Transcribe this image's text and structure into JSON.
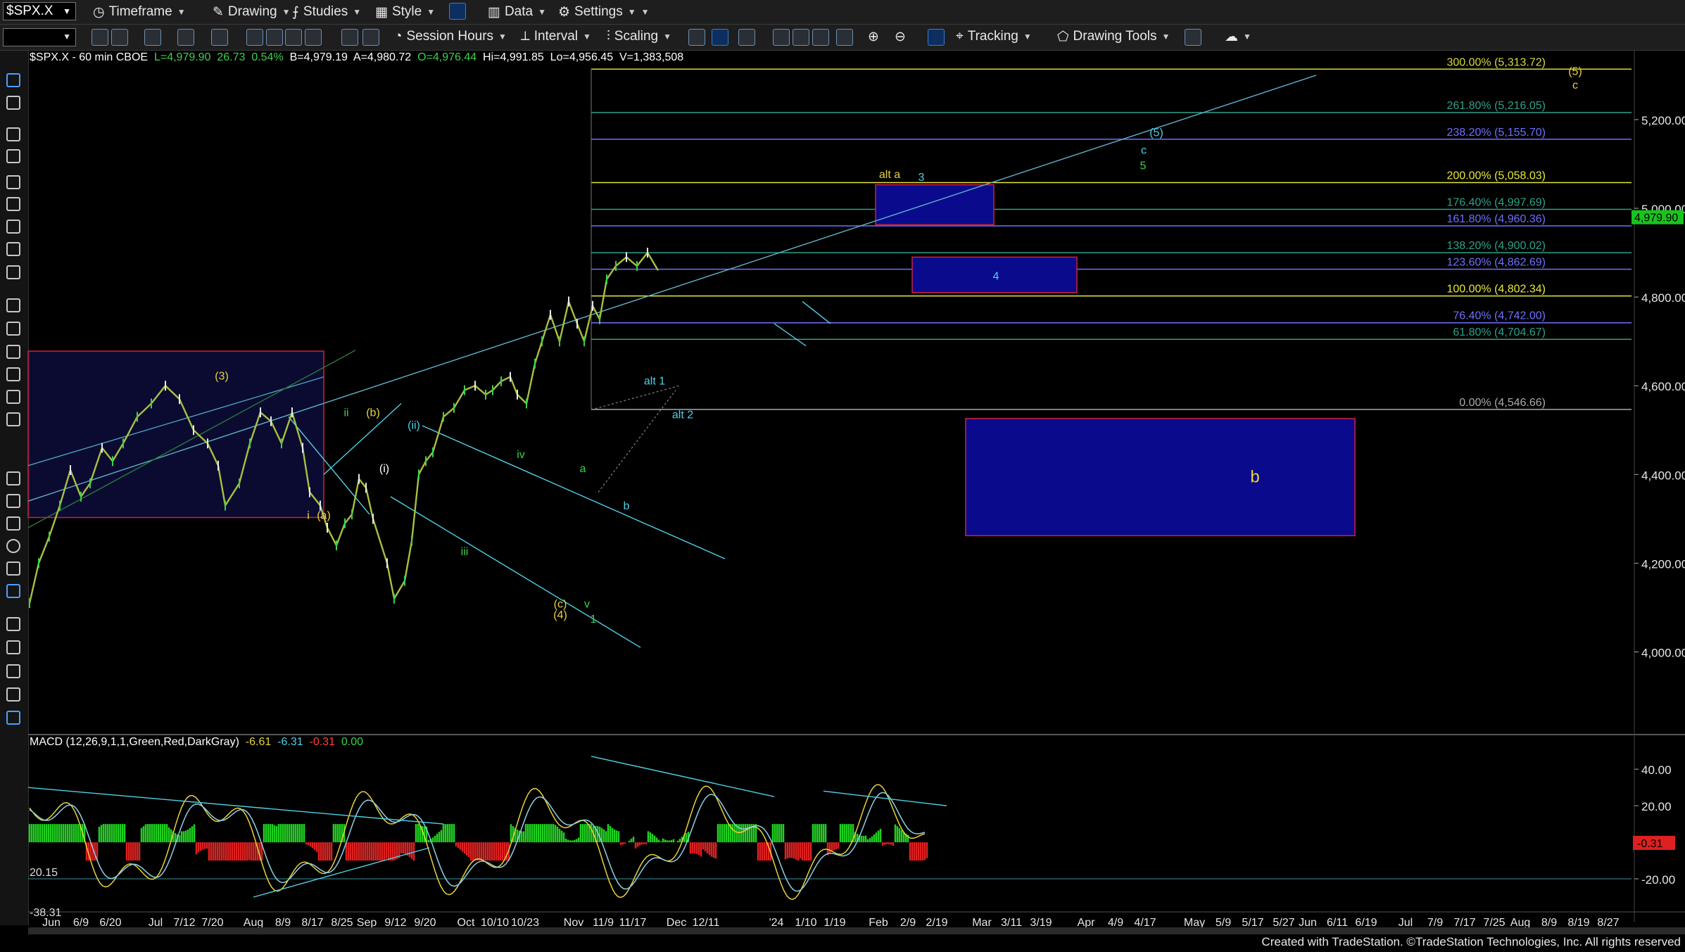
{
  "toolbar1": {
    "symbol": "$SPX.X",
    "items": [
      "Timeframe",
      "Drawing",
      "Studies",
      "Style",
      "Data",
      "Settings"
    ]
  },
  "toolbar2": {
    "items": [
      "Session Hours",
      "Interval",
      "Scaling",
      "Tracking",
      "Drawing Tools"
    ]
  },
  "info_line": {
    "symbol": "$SPX.X - 60 min  CBOE",
    "last": "L=4,979.90",
    "change": "26.73",
    "pct": "0.54%",
    "bid": "B=4,979.19",
    "ask": "A=4,980.72",
    "open": "O=4,976.44",
    "high": "Hi=4,991.85",
    "low": "Lo=4,956.45",
    "volume": "V=1,383,508"
  },
  "macd_info": {
    "label": "MACD (12,26,9,1,1,Green,Red,DarkGray)",
    "v1": "-6.61",
    "v2": "-6.31",
    "v3": "-0.31",
    "v4": "0.00"
  },
  "credit": "Created with TradeStation. ©TradeStation Technologies, Inc. All rights reserved",
  "chart_data": {
    "type": "line",
    "title": "$SPX.X - 60 min",
    "price_axis": {
      "ylim": [
        3820,
        5330
      ],
      "ticks": [
        "4,000.00",
        "4,200.00",
        "4,400.00",
        "4,600.00",
        "4,800.00",
        "5,000.00",
        "5,200.00"
      ],
      "tick_values": [
        4000,
        4200,
        4400,
        4600,
        4800,
        5000,
        5200
      ],
      "last_price_label": "4,979.90",
      "last_price": 4979.9
    },
    "macd_axis": {
      "ylim": [
        -35,
        52
      ],
      "ticks": [
        "40.00",
        "20.00",
        "-20.00"
      ],
      "tick_values": [
        40,
        20,
        -20
      ],
      "current_label": "-0.31",
      "current": -0.31,
      "left_labels": [
        "20.15",
        "-38.31"
      ]
    },
    "x_axis": {
      "labels": [
        "Jun",
        "6/9",
        "6/20",
        "Jul",
        "7/12",
        "7/20",
        "Aug",
        "8/9",
        "8/17",
        "8/25",
        "Sep",
        "9/12",
        "9/20",
        "Oct",
        "10/10",
        "10/23",
        "Nov",
        "11/9",
        "11/17",
        "Dec",
        "12/11",
        "'24",
        "1/10",
        "1/19",
        "Feb",
        "2/9",
        "2/19",
        "Mar",
        "3/11",
        "3/19",
        "Apr",
        "4/9",
        "4/17",
        "May",
        "5/9",
        "5/17",
        "5/27",
        "Jun",
        "6/11",
        "6/19",
        "Jul",
        "7/9",
        "7/17",
        "7/25",
        "Aug",
        "8/9",
        "8/19",
        "8/27"
      ],
      "positions": [
        73,
        115,
        157,
        221,
        262,
        302,
        360,
        402,
        444,
        486,
        521,
        562,
        604,
        662,
        703,
        746,
        815,
        857,
        899,
        961,
        1003,
        1103,
        1145,
        1186,
        1248,
        1290,
        1331,
        1395,
        1437,
        1479,
        1543,
        1585,
        1627,
        1697,
        1738,
        1780,
        1824,
        1858,
        1900,
        1941,
        1997,
        2039,
        2081,
        2123,
        2160,
        2201,
        2243,
        2285
      ]
    },
    "price_series": {
      "x": [
        42,
        55,
        70,
        85,
        100,
        115,
        128,
        145,
        160,
        175,
        195,
        215,
        235,
        255,
        275,
        295,
        310,
        320,
        340,
        355,
        370,
        385,
        400,
        415,
        430,
        440,
        455,
        465,
        478,
        490,
        500,
        510,
        520,
        530,
        550,
        560,
        575,
        585,
        595,
        605,
        615,
        630,
        645,
        660,
        675,
        690,
        700,
        712,
        725,
        735,
        748,
        760,
        770,
        782,
        795,
        808,
        820,
        830,
        842,
        852,
        862,
        875,
        890,
        905,
        920,
        935,
        950,
        965,
        980,
        995,
        1010,
        1025,
        1040,
        1052,
        1065,
        1080,
        1095,
        1110,
        1125,
        1140,
        1155,
        1168,
        1180,
        1192,
        1205,
        1215,
        1225,
        1235,
        1245,
        1252,
        1260,
        1268,
        1275,
        1283,
        1290,
        1297,
        1303,
        1308,
        1312,
        1318
      ],
      "y": [
        4110,
        4200,
        4260,
        4330,
        4410,
        4350,
        4380,
        4460,
        4430,
        4470,
        4530,
        4560,
        4600,
        4570,
        4500,
        4470,
        4420,
        4330,
        4380,
        4470,
        4540,
        4520,
        4470,
        4540,
        4460,
        4360,
        4330,
        4280,
        4240,
        4290,
        4310,
        4390,
        4370,
        4300,
        4200,
        4120,
        4160,
        4250,
        4400,
        4430,
        4450,
        4530,
        4550,
        4590,
        4600,
        4580,
        4590,
        4610,
        4620,
        4580,
        4560,
        4650,
        4700,
        4760,
        4700,
        4790,
        4740,
        4700,
        4780,
        4750,
        4840,
        4870,
        4890,
        4870,
        4900,
        4860,
        4930,
        4960,
        4960,
        4940,
        5000,
        5048,
        4980,
        4960,
        4979.9,
        4980,
        4968,
        4974,
        4979.9,
        4980,
        4979.9,
        4975,
        4979.9,
        4979.9,
        4980,
        4979.9,
        4979.9,
        4979.9,
        4979.9,
        4979.9,
        4979.9,
        4979.9,
        4979.9,
        4979.9,
        4979.9,
        4979.9,
        4979.9,
        4979.9,
        4979.9,
        4979.9
      ],
      "visible_count": 66
    },
    "fib_levels": [
      {
        "label": "300.00% (5,313.72)",
        "value": 5313.72,
        "color": "#d8d83a"
      },
      {
        "label": "261.80% (5,216.05)",
        "value": 5216.05,
        "color": "#2fa08a"
      },
      {
        "label": "238.20% (5,155.70)",
        "value": 5155.7,
        "color": "#6f6fff"
      },
      {
        "label": "200.00% (5,058.03)",
        "value": 5058.03,
        "color": "#e8e83a"
      },
      {
        "label": "176.40% (4,997.69)",
        "value": 4997.69,
        "color": "#2fa08a"
      },
      {
        "label": "161.80% (4,960.36)",
        "value": 4960.36,
        "color": "#6f6fff"
      },
      {
        "label": "138.20% (4,900.02)",
        "value": 4900.02,
        "color": "#2fa08a"
      },
      {
        "label": "123.60% (4,862.69)",
        "value": 4862.69,
        "color": "#6f6fff"
      },
      {
        "label": "100.00% (4,802.34)",
        "value": 4802.34,
        "color": "#e8e83a"
      },
      {
        "label": "76.40% (4,742.00)",
        "value": 4742.0,
        "color": "#6f6fff"
      },
      {
        "label": "61.80% (4,704.67)",
        "value": 4704.67,
        "color": "#2fa08a"
      },
      {
        "label": "0.00% (4,546.66)",
        "value": 4546.66,
        "color": "#aaaaaa"
      }
    ],
    "wave_labels": [
      {
        "text": "(3)",
        "color": "#e8d23b",
        "x": 315,
        "price": 4614
      },
      {
        "text": "i",
        "color": "#e8d23b",
        "x": 438,
        "price": 4300
      },
      {
        "text": "(a)",
        "color": "#e8d23b",
        "x": 460,
        "price": 4300
      },
      {
        "text": "ii",
        "color": "#3bd14a",
        "x": 492,
        "price": 4531
      },
      {
        "text": "(b)",
        "color": "#e8d23b",
        "x": 530,
        "price": 4531
      },
      {
        "text": "(i)",
        "color": "#fff",
        "x": 546,
        "price": 4405
      },
      {
        "text": "(ii)",
        "color": "#4fd0e6",
        "x": 588,
        "price": 4503
      },
      {
        "text": "iv",
        "color": "#3bd14a",
        "x": 740,
        "price": 4437
      },
      {
        "text": "iii",
        "color": "#3bd14a",
        "x": 660,
        "price": 4218
      },
      {
        "text": "(c)",
        "color": "#e8d23b",
        "x": 796,
        "price": 4100
      },
      {
        "text": "(4)",
        "color": "#e8d23b",
        "x": 796,
        "price": 4075
      },
      {
        "text": "v",
        "color": "#3bd14a",
        "x": 834,
        "price": 4100
      },
      {
        "text": "1",
        "color": "#3bd14a",
        "x": 843,
        "price": 4066
      },
      {
        "text": "a",
        "color": "#3bd14a",
        "x": 828,
        "price": 4405
      },
      {
        "text": "b",
        "color": "#4fd0e6",
        "x": 890,
        "price": 4321
      },
      {
        "text": "alt 1",
        "color": "#4fd0e6",
        "x": 930,
        "price": 4603
      },
      {
        "text": "alt 2",
        "color": "#4fd0e6",
        "x": 970,
        "price": 4527
      },
      {
        "text": "alt a",
        "color": "#e8d23b",
        "x": 1264,
        "price": 5068
      },
      {
        "text": "3",
        "color": "#4fd0e6",
        "x": 1309,
        "price": 5062
      },
      {
        "text": "4",
        "color": "#4fd0e6",
        "x": 1415,
        "price": 4839
      },
      {
        "text": "c",
        "color": "#4fd0e6",
        "x": 1625,
        "price": 5123
      },
      {
        "text": "5",
        "color": "#3bd14a",
        "x": 1624,
        "price": 5088
      },
      {
        "text": "(5)",
        "color": "#4fd0e6",
        "x": 1643,
        "price": 5163
      },
      {
        "text": "(5)",
        "color": "#e8d23b",
        "x": 2238,
        "price": 5301
      },
      {
        "text": "c",
        "color": "#e8d23b",
        "x": 2238,
        "price": 5270
      },
      {
        "text": "b",
        "color": "#e8d23b",
        "x": 1783,
        "price": 4382
      }
    ],
    "boxes": [
      {
        "x1": 40,
        "x2": 460,
        "p1": 4678,
        "p2": 4303
      },
      {
        "x1": 1244,
        "x2": 1412,
        "p1": 5053,
        "p2": 4963
      },
      {
        "x1": 1296,
        "x2": 1530,
        "p1": 4890,
        "p2": 4810
      },
      {
        "x1": 1372,
        "x2": 1925,
        "p1": 4526,
        "p2": 4262
      }
    ]
  }
}
